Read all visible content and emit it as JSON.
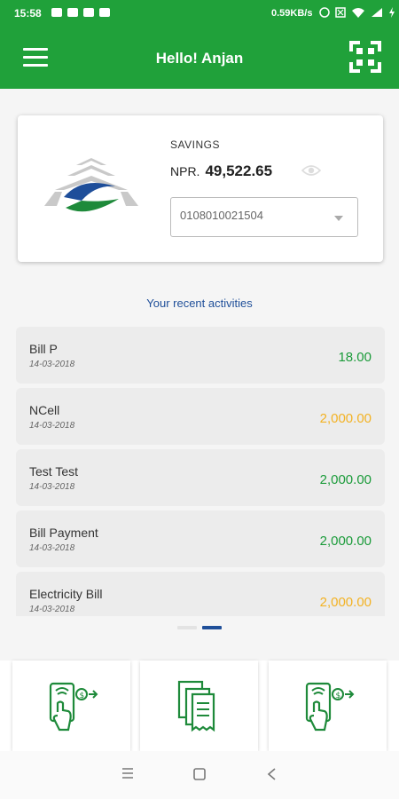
{
  "status_bar": {
    "time": "15:58",
    "net_speed": "0.59KB/s"
  },
  "app_bar": {
    "title": "Hello! Anjan",
    "menu_icon": "hamburger-menu-icon",
    "scan_icon": "qr-scan-icon",
    "background_color": "#20a13a"
  },
  "account": {
    "type": "SAVINGS",
    "currency": "NPR.",
    "balance": "49,522.65",
    "account_number": "0108010021504",
    "visibility_icon": "eye-icon"
  },
  "recent": {
    "title": "Your recent activities",
    "items": [
      {
        "name": "Bill P",
        "date": "14-03-2018",
        "amount": "18.00",
        "color": "#1b9b3a"
      },
      {
        "name": "NCell",
        "date": "14-03-2018",
        "amount": "2,000.00",
        "color": "#f3b223"
      },
      {
        "name": "Test Test",
        "date": "14-03-2018",
        "amount": "2,000.00",
        "color": "#1b9b3a"
      },
      {
        "name": "Bill Payment",
        "date": "14-03-2018",
        "amount": "2,000.00",
        "color": "#1b9b3a"
      },
      {
        "name": "Electricity Bill",
        "date": "14-03-2018",
        "amount": "2,000.00",
        "color": "#f3b223"
      }
    ]
  },
  "pager": {
    "pages": 2,
    "active_page": 2,
    "active_color": "#1f4f99",
    "inactive_color": "#e3e3e3"
  },
  "actions": [
    {
      "icon": "mobile-payment-icon"
    },
    {
      "icon": "statement-documents-icon"
    },
    {
      "icon": "mobile-transfer-icon"
    }
  ],
  "system_nav": {
    "recents_icon": "recents-icon",
    "home_icon": "home-icon",
    "back_icon": "back-icon"
  }
}
